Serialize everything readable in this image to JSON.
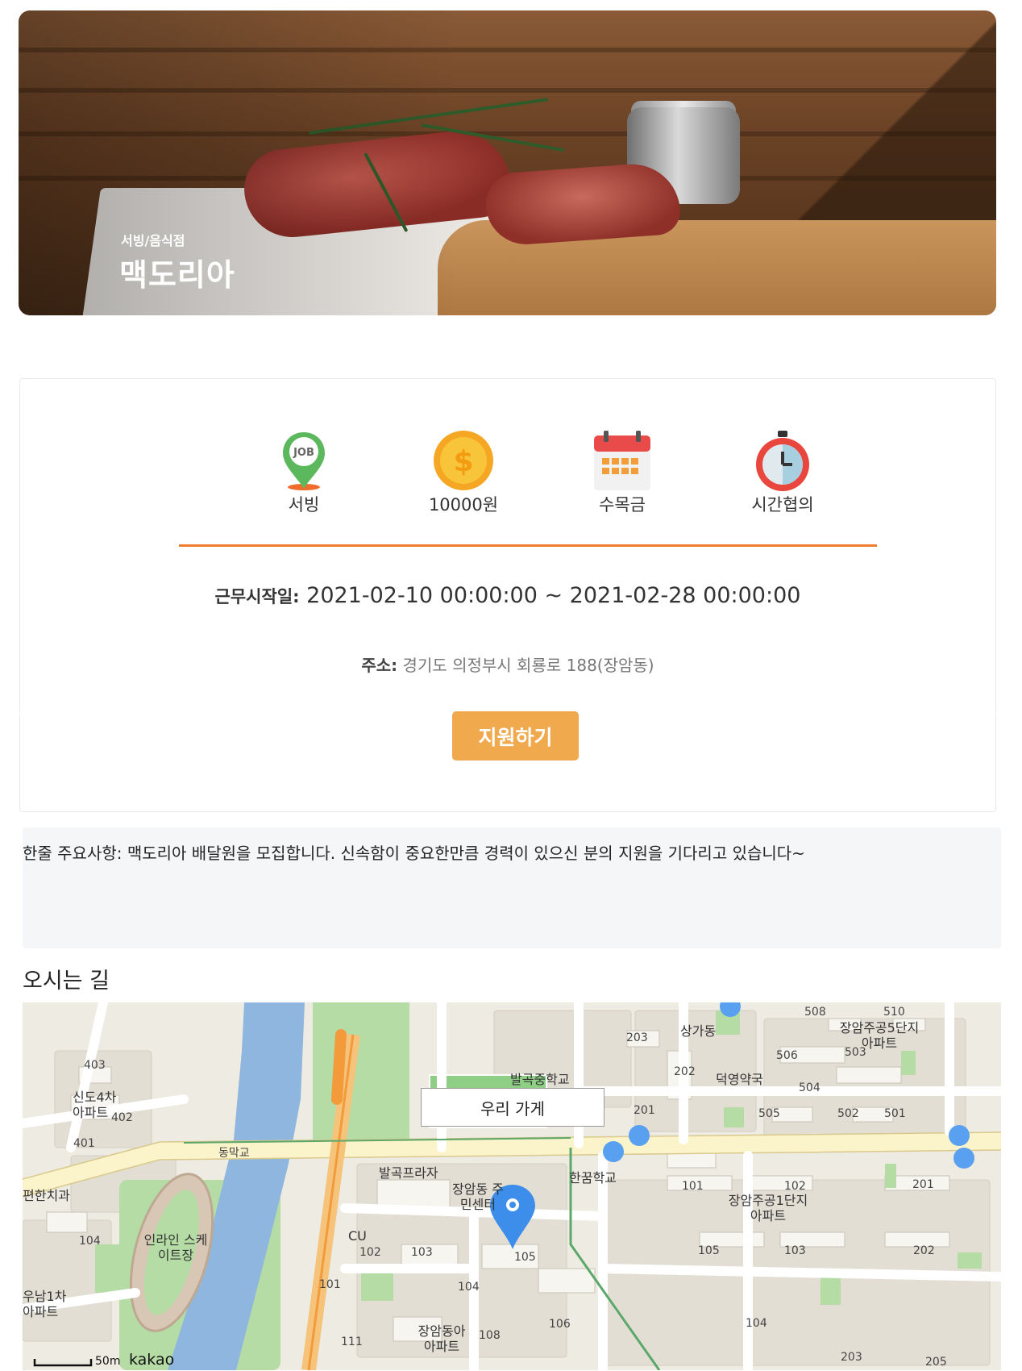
{
  "hero": {
    "category": "서빙/음식점",
    "store_name": "맥도리아"
  },
  "job_icons": [
    {
      "icon": "job-pin-icon",
      "label": "서빙"
    },
    {
      "icon": "coin-icon",
      "label": "10000원"
    },
    {
      "icon": "calendar-icon",
      "label": "수목금"
    },
    {
      "icon": "stopwatch-icon",
      "label": "시간협의"
    }
  ],
  "period": {
    "label": "근무시작일:",
    "value": "2021-02-10 00:00:00 ~ 2021-02-28 00:00:00"
  },
  "address": {
    "label": "주소:",
    "value": "경기도 의정부시 회룡로 188(장암동)"
  },
  "apply_button": "지원하기",
  "summary": {
    "text": "한줄 주요사항: 맥도리아 배달원을 모집합니다. 신속함이 중요한만큼 경력이 있으신 분의 지원을 기다리고 있습니다~"
  },
  "directions": {
    "title": "오시는 길"
  },
  "map": {
    "marker_label": "우리 가게",
    "scale": "50m",
    "brand": "kakao",
    "labels": [
      "403",
      "신도4차 아파트",
      "402",
      "401",
      "동막교",
      "편한치과",
      "104",
      "인라인 스케이트장",
      "우남1차 아파트",
      "발곡중학교",
      "발곡프라자",
      "장암동 주민센터",
      "CU",
      "102",
      "103",
      "105",
      "104",
      "101",
      "111",
      "장암동아 아파트",
      "108",
      "106",
      "한꿈학교",
      "203",
      "202",
      "201",
      "상가동",
      "덕영약국",
      "506",
      "504",
      "505",
      "502",
      "501",
      "503",
      "508",
      "510",
      "장암주공5단지 아파트",
      "101",
      "102",
      "201",
      "장암주공1단지 아파트",
      "105",
      "103",
      "202",
      "104",
      "203",
      "205"
    ],
    "colors": {
      "river": "#8fb6de",
      "park": "#a9d79a",
      "road": "#fbf3c9",
      "block": "#e3dfd6",
      "marker": "#3c8eea",
      "route": "#f39a3b"
    }
  }
}
